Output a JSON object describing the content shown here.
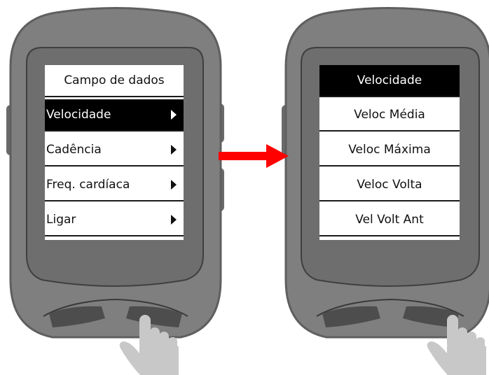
{
  "colors": {
    "device_body": "#7f7f7f",
    "device_bezel": "#6e6e6e",
    "arrow": "#ff0000",
    "hand": "#c8c8c8",
    "selected_bg": "#000000"
  },
  "left_screen": {
    "header": "Campo de dados",
    "items": [
      {
        "label": "Velocidade",
        "selected": true,
        "icon": "chevron-right-icon"
      },
      {
        "label": "Cadência",
        "selected": false,
        "icon": "chevron-right-icon"
      },
      {
        "label": "Freq. cardíaca",
        "selected": false,
        "icon": "chevron-right-icon"
      },
      {
        "label": "Ligar",
        "selected": false,
        "icon": "chevron-right-icon"
      }
    ]
  },
  "right_screen": {
    "items": [
      {
        "label": "Velocidade",
        "selected": true
      },
      {
        "label": "Veloc Média",
        "selected": false
      },
      {
        "label": "Veloc Máxima",
        "selected": false
      },
      {
        "label": "Veloc Volta",
        "selected": false
      },
      {
        "label": "Vel Volt Ant",
        "selected": false
      }
    ]
  },
  "icons": {
    "transition": "red-arrow-icon",
    "press": "pointing-hand-icon"
  }
}
